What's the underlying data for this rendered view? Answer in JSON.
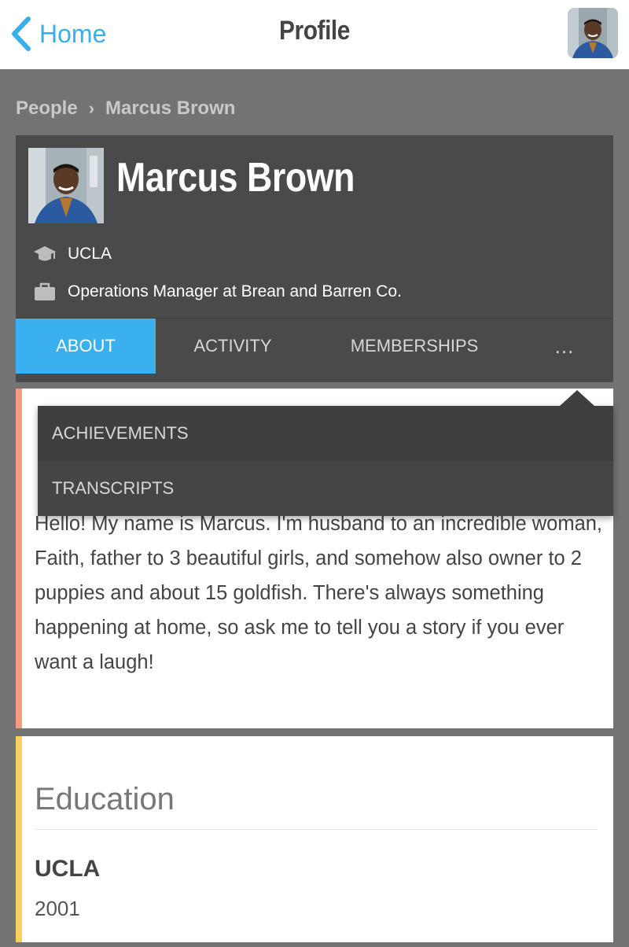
{
  "nav": {
    "back_label": "Home",
    "title": "Profile"
  },
  "breadcrumb": {
    "parent": "People",
    "separator": "›",
    "current": "Marcus Brown"
  },
  "profile": {
    "name": "Marcus Brown",
    "school": "UCLA",
    "job": "Operations Manager at Brean and Barren Co."
  },
  "tabs": [
    {
      "label": "ABOUT",
      "active": true
    },
    {
      "label": "ACTIVITY",
      "active": false
    },
    {
      "label": "MEMBERSHIPS",
      "active": false
    },
    {
      "label": "...",
      "active": false
    }
  ],
  "dropdown": {
    "items": [
      "ACHIEVEMENTS",
      "TRANSCRIPTS"
    ]
  },
  "about": {
    "text": "Hello! My name is Marcus. I'm husband to an incredible woman, Faith, father to 3 beautiful girls, and somehow also owner to 2 puppies and about 15 goldfish. There's always something happening at home, so ask me to tell you a story if you ever want a laugh!"
  },
  "education": {
    "title": "Education",
    "school": "UCLA",
    "year": "2001"
  },
  "colors": {
    "accent": "#3ab0ef",
    "about_border": "#f29b7e",
    "education_border": "#f7cf5e",
    "header_bg": "#4a4a4a",
    "page_bg": "#737373"
  },
  "icons": {
    "back": "chevron-left-icon",
    "school": "graduation-cap-icon",
    "job": "briefcase-icon"
  }
}
